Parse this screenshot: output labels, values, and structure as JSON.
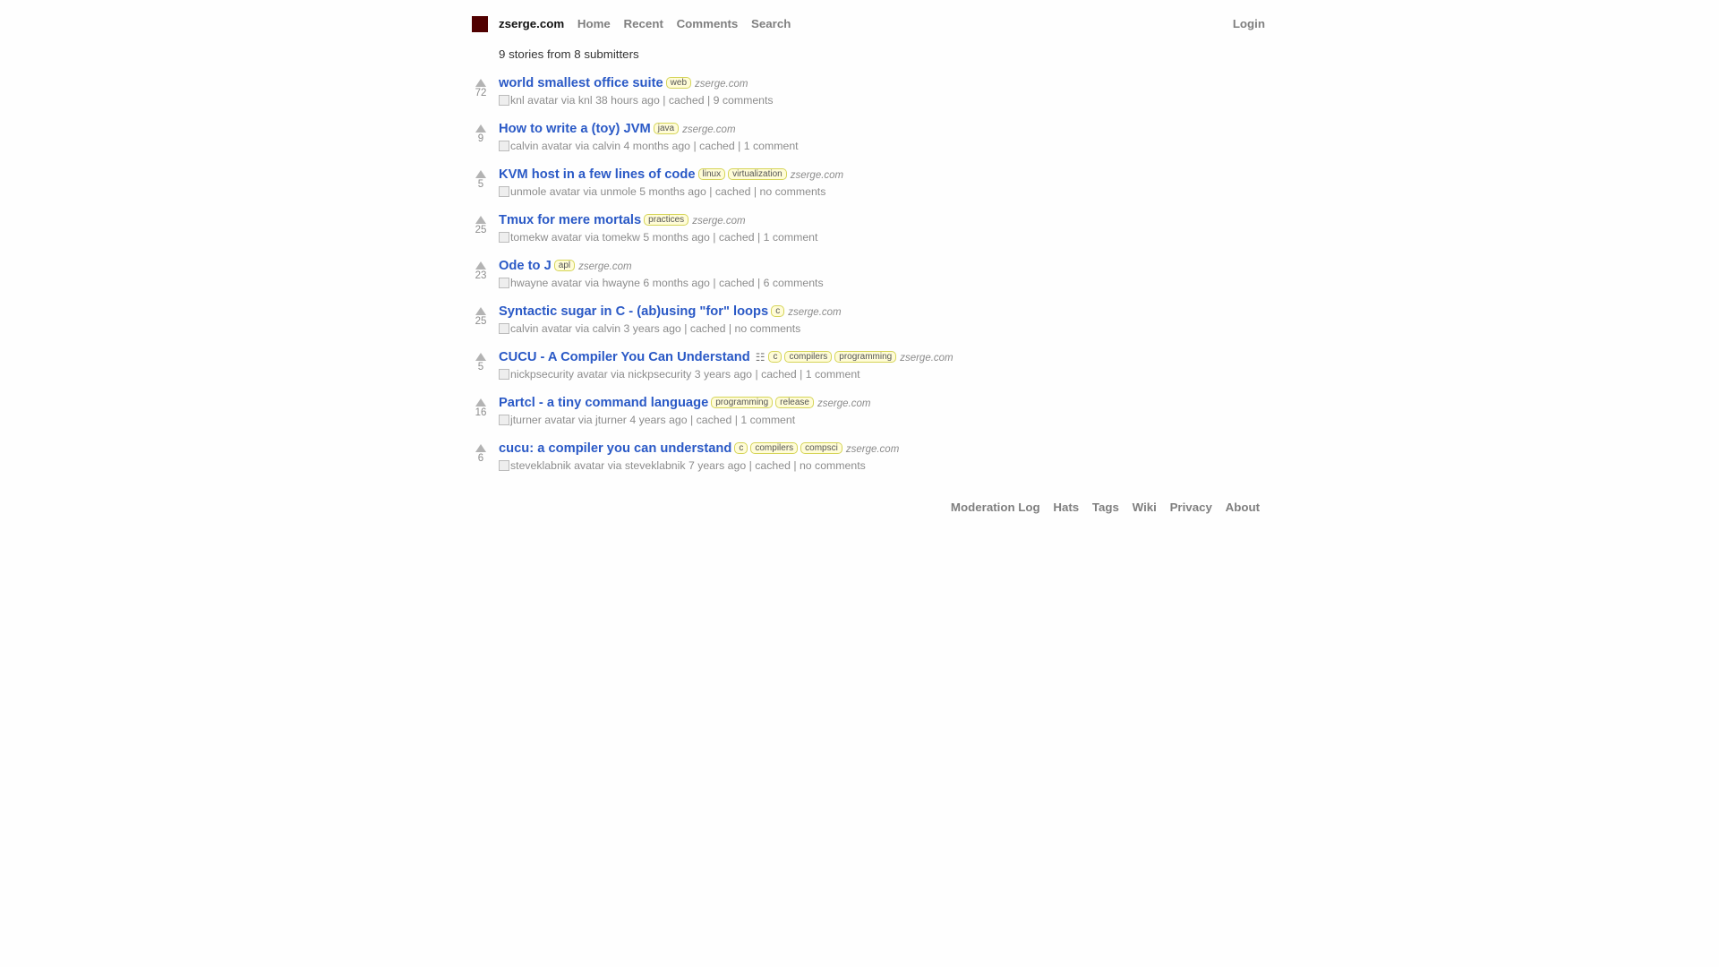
{
  "header": {
    "site": "zserge.com",
    "nav": [
      "Home",
      "Recent",
      "Comments",
      "Search"
    ],
    "login": "Login"
  },
  "summary": "9 stories from 8 submitters",
  "stories": [
    {
      "score": "72",
      "title": "world smallest office suite",
      "tags": [
        "web"
      ],
      "domain": "zserge.com",
      "has_description": false,
      "avatar_alt": "knl avatar",
      "user": "knl",
      "time": "38 hours ago",
      "cached": "cached",
      "comments": "9 comments"
    },
    {
      "score": "9",
      "title": "How to write a (toy) JVM",
      "tags": [
        "java"
      ],
      "domain": "zserge.com",
      "has_description": false,
      "avatar_alt": "calvin avatar",
      "user": "calvin",
      "time": "4 months ago",
      "cached": "cached",
      "comments": "1 comment"
    },
    {
      "score": "5",
      "title": "KVM host in a few lines of code",
      "tags": [
        "linux",
        "virtualization"
      ],
      "domain": "zserge.com",
      "has_description": false,
      "avatar_alt": "unmole avatar",
      "user": "unmole",
      "time": "5 months ago",
      "cached": "cached",
      "comments": "no comments"
    },
    {
      "score": "25",
      "title": "Tmux for mere mortals",
      "tags": [
        "practices"
      ],
      "domain": "zserge.com",
      "has_description": false,
      "avatar_alt": "tomekw avatar",
      "user": "tomekw",
      "time": "5 months ago",
      "cached": "cached",
      "comments": "1 comment"
    },
    {
      "score": "23",
      "title": "Ode to J",
      "tags": [
        "apl"
      ],
      "domain": "zserge.com",
      "has_description": false,
      "avatar_alt": "hwayne avatar",
      "user": "hwayne",
      "time": "6 months ago",
      "cached": "cached",
      "comments": "6 comments"
    },
    {
      "score": "25",
      "title": "Syntactic sugar in C - (ab)using \"for\" loops",
      "tags": [
        "c"
      ],
      "domain": "zserge.com",
      "has_description": false,
      "avatar_alt": "calvin avatar",
      "user": "calvin",
      "time": "3 years ago",
      "cached": "cached",
      "comments": "no comments"
    },
    {
      "score": "5",
      "title": "CUCU - A Compiler You Can Understand",
      "tags": [
        "c",
        "compilers",
        "programming"
      ],
      "domain": "zserge.com",
      "has_description": true,
      "avatar_alt": "nickpsecurity avatar",
      "user": "nickpsecurity",
      "time": "3 years ago",
      "cached": "cached",
      "comments": "1 comment"
    },
    {
      "score": "16",
      "title": "Partcl - a tiny command language",
      "tags": [
        "programming",
        "release"
      ],
      "domain": "zserge.com",
      "has_description": false,
      "avatar_alt": "jturner avatar",
      "user": "jturner",
      "time": "4 years ago",
      "cached": "cached",
      "comments": "1 comment"
    },
    {
      "score": "6",
      "title": "cucu: a compiler you can understand",
      "tags": [
        "c",
        "compilers",
        "compsci"
      ],
      "domain": "zserge.com",
      "has_description": false,
      "avatar_alt": "steveklabnik avatar",
      "user": "steveklabnik",
      "time": "7 years ago",
      "cached": "cached",
      "comments": "no comments"
    }
  ],
  "labels": {
    "via": "via",
    "separator": "|"
  },
  "footer": [
    "Moderation Log",
    "Hats",
    "Tags",
    "Wiki",
    "Privacy",
    "About"
  ],
  "colors": {
    "accent": "#500000",
    "link": "#2a59c6",
    "tag_bg": "#fffcd7",
    "tag_border": "#d5d458"
  }
}
